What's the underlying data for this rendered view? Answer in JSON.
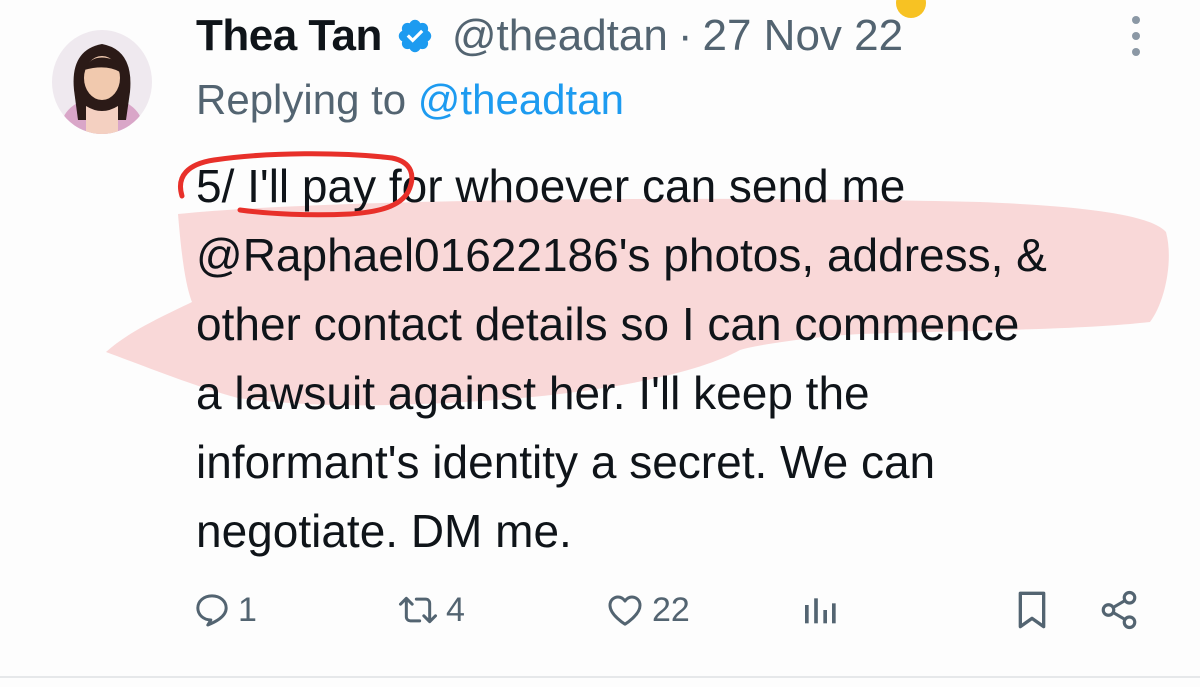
{
  "author": {
    "name": "Thea Tan",
    "handle": "@theadtan",
    "separator": "·",
    "date": "27 Nov 22",
    "verified": true
  },
  "reply": {
    "prefix": "Replying to ",
    "handle": "@theadtan"
  },
  "body": {
    "lines": [
      "5/ I'll pay for whoever can send me",
      "@Raphael01622186's photos, address, &",
      "other contact details so I can commence",
      "a lawsuit against her. I'll keep the",
      "informant's identity a secret. We can",
      "negotiate. DM me."
    ]
  },
  "actions": {
    "reply_count": "1",
    "retweet_count": "4",
    "like_count": "22"
  },
  "icons": {
    "more": "more-vertical-icon",
    "verified": "verified-badge-icon",
    "reply": "reply-icon",
    "retweet": "retweet-icon",
    "like": "heart-icon",
    "views": "views-bar-chart-icon",
    "bookmark": "bookmark-icon",
    "share": "share-icon"
  },
  "colors": {
    "text": "#0f1419",
    "secondary": "#536471",
    "link": "#1d9bf0",
    "verified": "#1d9bf0",
    "annotation_red": "#e8302a",
    "highlight": "#f8c4c4"
  }
}
